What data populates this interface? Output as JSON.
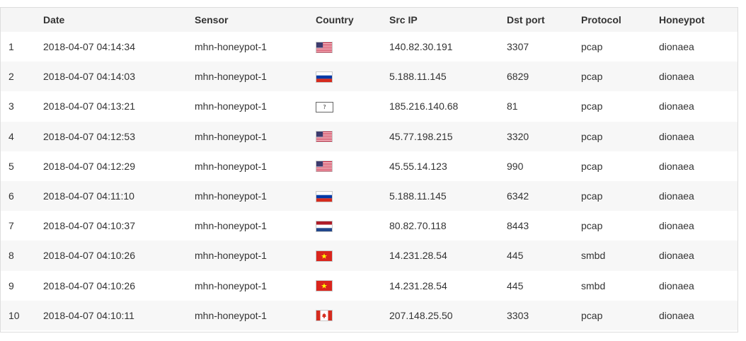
{
  "columns": {
    "index": "",
    "date": "Date",
    "sensor": "Sensor",
    "country": "Country",
    "src_ip": "Src IP",
    "dst_port": "Dst port",
    "protocol": "Protocol",
    "honeypot": "Honeypot"
  },
  "rows": [
    {
      "index": "1",
      "date": "2018-04-07 04:14:34",
      "sensor": "mhn-honeypot-1",
      "country_flag": "us-flag-icon",
      "src_ip": "140.82.30.191",
      "dst_port": "3307",
      "protocol": "pcap",
      "honeypot": "dionaea"
    },
    {
      "index": "2",
      "date": "2018-04-07 04:14:03",
      "sensor": "mhn-honeypot-1",
      "country_flag": "ru-flag-icon",
      "src_ip": "5.188.11.145",
      "dst_port": "6829",
      "protocol": "pcap",
      "honeypot": "dionaea"
    },
    {
      "index": "3",
      "date": "2018-04-07 04:13:21",
      "sensor": "mhn-honeypot-1",
      "country_flag": "unknown-flag-icon",
      "country_unknown_text": "?",
      "src_ip": "185.216.140.68",
      "dst_port": "81",
      "protocol": "pcap",
      "honeypot": "dionaea"
    },
    {
      "index": "4",
      "date": "2018-04-07 04:12:53",
      "sensor": "mhn-honeypot-1",
      "country_flag": "us-flag-icon",
      "src_ip": "45.77.198.215",
      "dst_port": "3320",
      "protocol": "pcap",
      "honeypot": "dionaea"
    },
    {
      "index": "5",
      "date": "2018-04-07 04:12:29",
      "sensor": "mhn-honeypot-1",
      "country_flag": "us-flag-icon",
      "src_ip": "45.55.14.123",
      "dst_port": "990",
      "protocol": "pcap",
      "honeypot": "dionaea"
    },
    {
      "index": "6",
      "date": "2018-04-07 04:11:10",
      "sensor": "mhn-honeypot-1",
      "country_flag": "ru-flag-icon",
      "src_ip": "5.188.11.145",
      "dst_port": "6342",
      "protocol": "pcap",
      "honeypot": "dionaea"
    },
    {
      "index": "7",
      "date": "2018-04-07 04:10:37",
      "sensor": "mhn-honeypot-1",
      "country_flag": "nl-flag-icon",
      "src_ip": "80.82.70.118",
      "dst_port": "8443",
      "protocol": "pcap",
      "honeypot": "dionaea"
    },
    {
      "index": "8",
      "date": "2018-04-07 04:10:26",
      "sensor": "mhn-honeypot-1",
      "country_flag": "vn-flag-icon",
      "src_ip": "14.231.28.54",
      "dst_port": "445",
      "protocol": "smbd",
      "honeypot": "dionaea"
    },
    {
      "index": "9",
      "date": "2018-04-07 04:10:26",
      "sensor": "mhn-honeypot-1",
      "country_flag": "vn-flag-icon",
      "src_ip": "14.231.28.54",
      "dst_port": "445",
      "protocol": "smbd",
      "honeypot": "dionaea"
    },
    {
      "index": "10",
      "date": "2018-04-07 04:10:11",
      "sensor": "mhn-honeypot-1",
      "country_flag": "ca-flag-icon",
      "src_ip": "207.148.25.50",
      "dst_port": "3303",
      "protocol": "pcap",
      "honeypot": "dionaea"
    }
  ],
  "colors": {
    "header_bg": "#f5f5f5",
    "stripe_bg": "#f7f7f7",
    "border": "#dddddd",
    "text": "#333333"
  }
}
